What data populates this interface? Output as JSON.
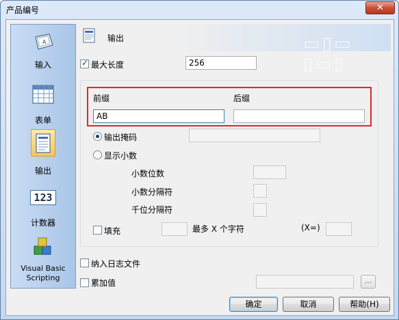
{
  "window": {
    "title": "产品编号",
    "close_label": "✕"
  },
  "sidebar": {
    "items": [
      {
        "label": "输入"
      },
      {
        "label": "表单"
      },
      {
        "label": "输出"
      },
      {
        "label": "计数器",
        "icon_text": "123"
      },
      {
        "label": "Visual Basic Scripting"
      }
    ],
    "active": "输出"
  },
  "header": {
    "title": "输出"
  },
  "max_length": {
    "label": "最大长度",
    "checked": true,
    "value": "256"
  },
  "prefix": {
    "label": "前缀",
    "value": "AB"
  },
  "suffix": {
    "label": "后缀",
    "value": ""
  },
  "output_mask": {
    "label": "输出掩码",
    "selected": true,
    "value": ""
  },
  "show_decimal": {
    "label": "显示小数",
    "decimal_places_label": "小数位数",
    "decimal_separator_label": "小数分隔符",
    "thousands_separator_label": "千位分隔符"
  },
  "fill": {
    "label": "填充",
    "max_label": "最多 X 个字符",
    "x_label": "(X=)"
  },
  "log_file": {
    "label": "纳入日志文件"
  },
  "accumulate": {
    "label": "累加值",
    "ellipsis": "..."
  },
  "buttons": {
    "ok": "确定",
    "cancel": "取消",
    "help": "帮助(H)"
  },
  "colors": {
    "highlight_border": "#e0272b",
    "sidebar": "#a9c5e8",
    "active_item": "#f6c658"
  }
}
